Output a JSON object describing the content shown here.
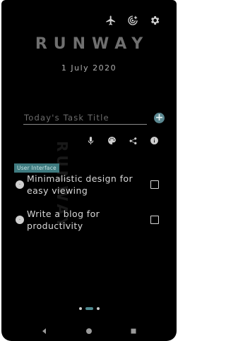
{
  "app": {
    "title": "RUNWAY",
    "date": "1 July 2020",
    "watermark": "RUNWAY"
  },
  "top_icons": [
    "airplane-icon",
    "target-icon",
    "gear-icon"
  ],
  "task_input": {
    "placeholder": "Today's Task Title",
    "value": ""
  },
  "add_button": {
    "label": "+"
  },
  "tools": [
    "microphone-icon",
    "palette-icon",
    "share-icon",
    "info-icon"
  ],
  "category_tag": "User Interface",
  "tasks": [
    {
      "bullet": "·",
      "text": "Minimalistic design for easy viewing",
      "checked": false
    },
    {
      "bullet": "·",
      "text": "Write a blog for productivity",
      "checked": false
    }
  ],
  "pager": {
    "pages": 3,
    "active": 1
  },
  "colors": {
    "background": "#000000",
    "accent": "#4f8b91",
    "text": "#d8d8d8"
  }
}
